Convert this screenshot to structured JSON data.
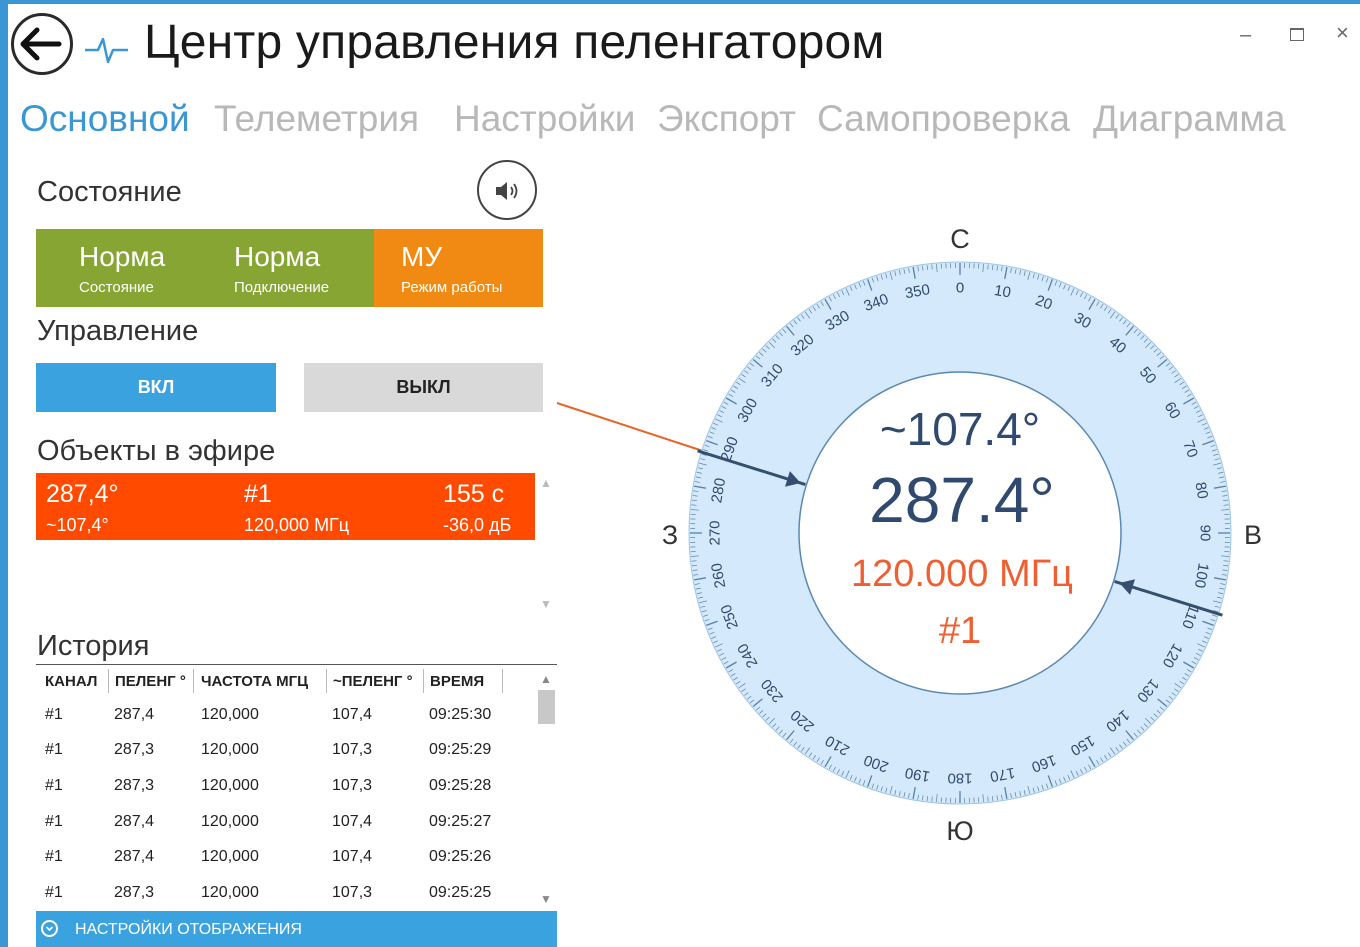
{
  "window": {
    "title": "Центр управления пеленгатором",
    "controls": {
      "minimize": "–",
      "close": "×"
    }
  },
  "tabs": [
    {
      "label": "Основной",
      "active": true
    },
    {
      "label": "Телеметрия",
      "active": false
    },
    {
      "label": "Настройки",
      "active": false
    },
    {
      "label": "Экспорт",
      "active": false
    },
    {
      "label": "Самопроверка",
      "active": false
    },
    {
      "label": "Диаграмма",
      "active": false
    }
  ],
  "state": {
    "title": "Состояние",
    "tiles": [
      {
        "value": "Норма",
        "caption": "Состояние",
        "color": "#86a532"
      },
      {
        "value": "Норма",
        "caption": "Подключение",
        "color": "#86a532"
      },
      {
        "value": "МУ",
        "caption": "Режим работы",
        "color": "#f08a12"
      }
    ]
  },
  "control": {
    "title": "Управление",
    "on_label": "ВКЛ",
    "off_label": "ВЫКЛ"
  },
  "objects": {
    "title": "Объекты в эфире",
    "items": [
      {
        "bearing": "287,4°",
        "reverse": "~107,4°",
        "channel": "#1",
        "frequency": "120,000 МГц",
        "time": "155 с",
        "level": "-36,0 дБ"
      }
    ]
  },
  "history": {
    "title": "История",
    "columns": [
      "КАНАЛ",
      "ПЕЛЕНГ °",
      "ЧАСТОТА МГЦ",
      "~ПЕЛЕНГ °",
      "ВРЕМЯ"
    ],
    "rows": [
      [
        "#1",
        "287,4",
        "120,000",
        "107,4",
        "09:25:30"
      ],
      [
        "#1",
        "287,3",
        "120,000",
        "107,3",
        "09:25:29"
      ],
      [
        "#1",
        "287,3",
        "120,000",
        "107,3",
        "09:25:28"
      ],
      [
        "#1",
        "287,4",
        "120,000",
        "107,4",
        "09:25:27"
      ],
      [
        "#1",
        "287,4",
        "120,000",
        "107,4",
        "09:25:26"
      ],
      [
        "#1",
        "287,3",
        "120,000",
        "107,3",
        "09:25:25"
      ]
    ]
  },
  "display_settings_label": "НАСТРОЙКИ ОТОБРАЖЕНИЯ",
  "compass": {
    "cardinals": {
      "north": "С",
      "east": "В",
      "south": "Ю",
      "west": "З"
    },
    "reverse_text": "~107.4°",
    "bearing_text": "287.4°",
    "frequency_text": "120.000 МГц",
    "channel_text": "#1",
    "bearing_deg": 287.4,
    "reverse_deg": 107.4,
    "label_step_deg": 10
  },
  "colors": {
    "accent": "#3a97d3",
    "ok": "#86a532",
    "warn": "#f08a12",
    "alert": "#ff4a00",
    "dial": "#d4e9fb",
    "needle": "#34506e"
  },
  "icons": [
    "back-arrow-icon",
    "pulse-logo-icon",
    "speaker-icon",
    "chevron-down-circle-icon"
  ]
}
